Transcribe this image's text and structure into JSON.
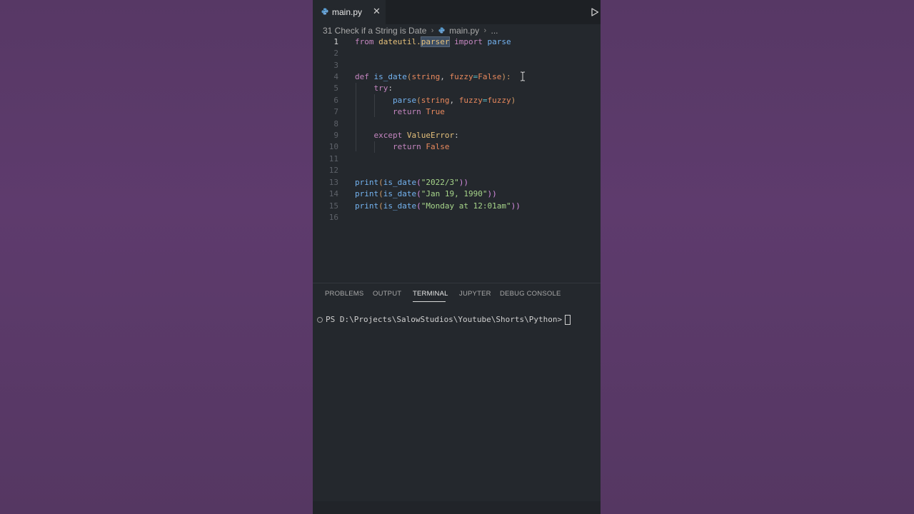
{
  "tab": {
    "label": "main.py",
    "close": "✕"
  },
  "breadcrumb": {
    "folder": "31 Check if a String is Date",
    "file": "main.py",
    "more": "..."
  },
  "code": {
    "line_numbers": [
      "1",
      "2",
      "3",
      "4",
      "5",
      "6",
      "7",
      "8",
      "9",
      "10",
      "11",
      "12",
      "13",
      "14",
      "15",
      "16"
    ],
    "l1": {
      "from": "from",
      "module": "dateutil.",
      "sub": "parser",
      "import": "import",
      "name": "parse"
    },
    "l4": {
      "def": "def",
      "fname": "is_date",
      "open": "(",
      "p1": "string",
      "comma": ", ",
      "p2": "fuzzy",
      "eq": "=",
      "val": "False",
      "close": "):"
    },
    "l5": {
      "try": "try",
      "colon": ":"
    },
    "l6": {
      "call": "parse",
      "open": "(",
      "a1": "string",
      "comma": ", ",
      "a2": "fuzzy",
      "eq": "=",
      "a3": "fuzzy",
      "close": ")"
    },
    "l7": {
      "ret": "return",
      "val": "True"
    },
    "l9": {
      "except": "except",
      "cls": "ValueError",
      "colon": ":"
    },
    "l10": {
      "ret": "return",
      "val": "False"
    },
    "l13": {
      "print": "print",
      "open": "(",
      "fn": "is_date",
      "open2": "(",
      "arg": "\"2022/3\"",
      "close": "))"
    },
    "l14": {
      "print": "print",
      "open": "(",
      "fn": "is_date",
      "open2": "(",
      "arg": "\"Jan 19, 1990\"",
      "close": "))"
    },
    "l15": {
      "print": "print",
      "open": "(",
      "fn": "is_date",
      "open2": "(",
      "arg": "\"Monday at 12:01am\"",
      "close": "))"
    }
  },
  "panel": {
    "tabs": [
      "PROBLEMS",
      "OUTPUT",
      "TERMINAL",
      "JUPYTER",
      "DEBUG CONSOLE"
    ],
    "active_tab": "TERMINAL",
    "prompt": "PS D:\\Projects\\SalowStudios\\Youtube\\Shorts\\Python>"
  },
  "icons": {
    "file": "python-file-icon",
    "run": "run-icon",
    "close": "close-icon"
  },
  "colors": {
    "background": "#5b3a6a",
    "editor": "#24282d",
    "keyword": "#c586c0",
    "function": "#74b3f0",
    "string": "#a7d58a"
  }
}
